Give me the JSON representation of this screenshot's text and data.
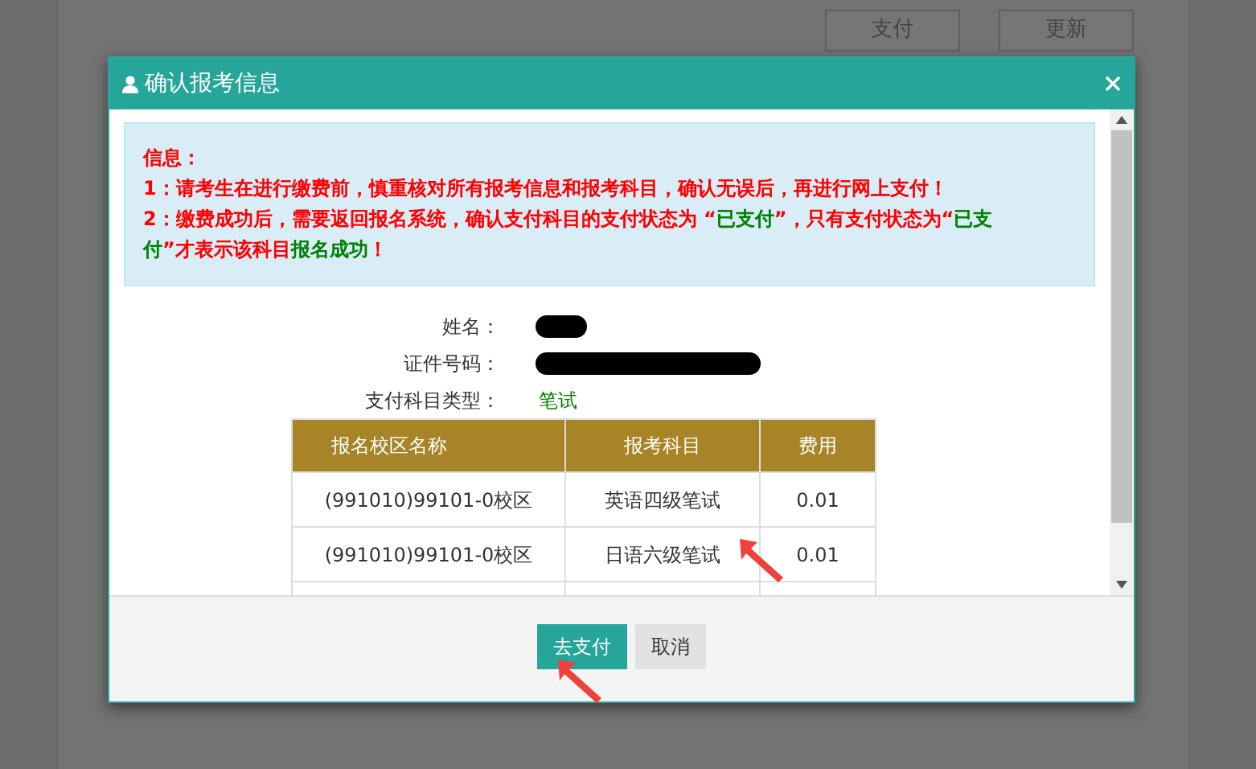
{
  "background_page": {
    "buttons": [
      "支付",
      "更新"
    ]
  },
  "dialog": {
    "title": "确认报考信息",
    "notice": {
      "heading": "信息：",
      "lines": [
        [
          {
            "kind": "alert",
            "text": "1：请考生在进行缴费前，慎重核对所有报考信息和报考科目，确认无误后，再进行网上支付！"
          }
        ],
        [
          {
            "kind": "alert",
            "text": "2：缴费成功后，需要返回报名系统，确认支付科目的支付状态为 “"
          },
          {
            "kind": "ok",
            "text": "已支付"
          },
          {
            "kind": "alert",
            "text": "”，只有支付状态为“"
          },
          {
            "kind": "ok",
            "text": "已支付"
          },
          {
            "kind": "alert",
            "text": "”才表示该科目"
          },
          {
            "kind": "ok",
            "text": "报名成功"
          },
          {
            "kind": "alert",
            "text": "！"
          }
        ]
      ]
    },
    "fields": [
      {
        "label": "姓名：",
        "kind": "redacted"
      },
      {
        "label": "证件号码：",
        "kind": "redacted"
      },
      {
        "label": "支付科目类型：",
        "kind": "text",
        "value": "笔试"
      }
    ],
    "table": {
      "columns": [
        "报名校区名称",
        "报考科目",
        "费用"
      ],
      "rows": [
        [
          "(991010)99101-0校区",
          "英语四级笔试",
          "0.01"
        ],
        [
          "(991010)99101-0校区",
          "日语六级笔试",
          "0.01"
        ]
      ]
    },
    "buttons": [
      {
        "label": "去支付",
        "kind": "primary"
      },
      {
        "label": "取消",
        "kind": "default"
      }
    ]
  }
}
